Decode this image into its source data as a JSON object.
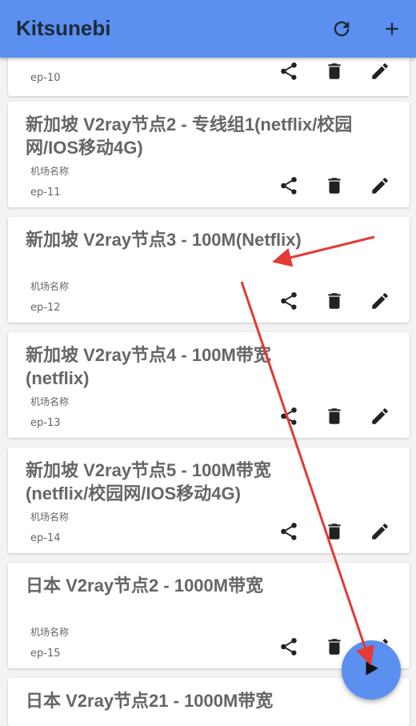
{
  "app": {
    "title": "Kitsunebi"
  },
  "toolbar": {
    "refresh_icon": "refresh-icon",
    "add_icon": "add-icon"
  },
  "colors": {
    "appbar": "#5b8ff0",
    "fab": "#5b8ff0",
    "arrow": "#e53935",
    "icon": "#222222"
  },
  "servers": [
    {
      "name": "",
      "group": "",
      "ep": "ep-10"
    },
    {
      "name": "新加坡 V2ray节点2 - 专线组1(netflix/校园网/IOS移动4G)",
      "group": "机场名称",
      "ep": "ep-11"
    },
    {
      "name": "新加坡 V2ray节点3 - 100M(Netflix)",
      "group": "机场名称",
      "ep": "ep-12"
    },
    {
      "name": "新加坡 V2ray节点4 - 100M带宽(netflix)",
      "group": "机场名称",
      "ep": "ep-13"
    },
    {
      "name": "新加坡 V2ray节点5 - 100M带宽(netflix/校园网/IOS移动4G)",
      "group": "机场名称",
      "ep": "ep-14"
    },
    {
      "name": "日本 V2ray节点2 - 1000M带宽",
      "group": "机场名称",
      "ep": "ep-15"
    },
    {
      "name": "日本 V2ray节点21 - 1000M带宽",
      "group": "",
      "ep": ""
    }
  ],
  "card_icons": [
    "share-icon",
    "delete-icon",
    "edit-icon"
  ],
  "fab": {
    "icon": "play-icon"
  }
}
